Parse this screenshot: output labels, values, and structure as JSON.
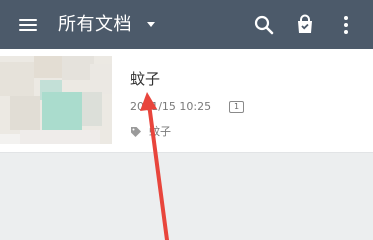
{
  "app_bar": {
    "title": "所有文档",
    "icons": [
      "menu-icon",
      "dropdown-caret-icon",
      "search-icon",
      "bag-icon",
      "more-vertical-icon"
    ],
    "background": "#4c5a6a"
  },
  "document": {
    "title": "蚊子",
    "date": "20 /1/15 10:25",
    "page_count": "1",
    "tag": "蚊子"
  },
  "annotation": {
    "color": "#e8453c"
  }
}
